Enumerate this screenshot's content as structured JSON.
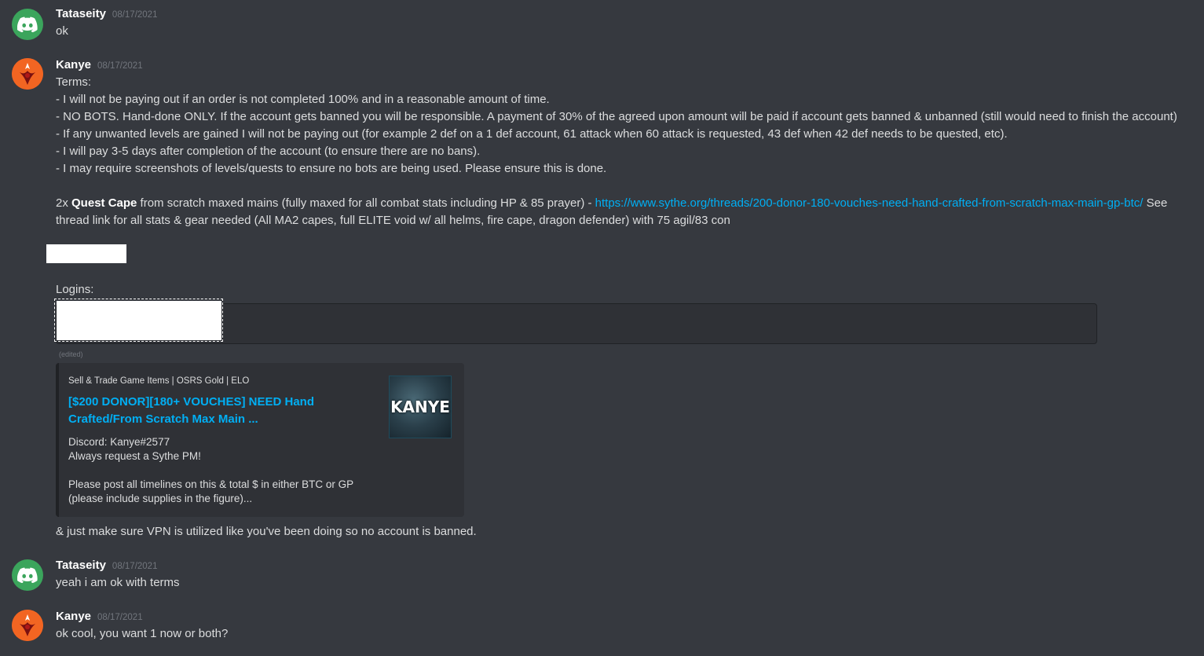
{
  "messages": [
    {
      "username": "Tataseity",
      "timestamp": "08/17/2021",
      "text": "ok"
    },
    {
      "username": "Kanye",
      "timestamp": "08/17/2021",
      "lines": [
        "Terms:",
        "- I will not be paying out if an order is not completed 100% and in a reasonable amount of time.",
        "- NO BOTS. Hand-done ONLY. If the account gets banned you will be responsible. A payment of 30% of the agreed upon amount will be paid if account gets banned & unbanned (still would need to finish the account)",
        "- If any unwanted levels are gained I will not be paying out (for example 2 def on a 1 def account, 61 attack when 60 attack is requested, 43 def when 42 def needs to be quested, etc).",
        "- I will pay 3-5 days after completion of the account (to ensure there are no bans).",
        "- I may require screenshots of levels/quests to ensure no bots are being used. Please ensure this is done."
      ],
      "quest_prefix": "2x ",
      "quest_bold": "Quest Cape",
      "quest_middle": " from scratch maxed mains (fully maxed for all combat stats including HP & 85 prayer) - ",
      "quest_link": "https://www.sythe.org/threads/200-donor-180-vouches-need-hand-crafted-from-scratch-max-main-gp-btc/",
      "quest_suffix": " See",
      "quest_line2": "thread link for all stats & gear needed (All MA2 capes, full ELITE void w/ all helms, fire cape, dragon defender) with 75 agil/83 con",
      "logins_label": "Logins:",
      "edited_label": "(edited)",
      "embed": {
        "provider": "Sell & Trade Game Items | OSRS Gold | ELO",
        "title_line1": "[$200 DONOR][180+ VOUCHES] NEED Hand",
        "title_line2": "Crafted/From Scratch Max Main ...",
        "desc_lines": [
          "Discord: Kanye#2577",
          "Always request a Sythe PM!",
          "",
          "Please post all timelines on this & total $ in either BTC or GP",
          "(please include supplies in the figure)..."
        ],
        "thumbnail_text": "KANYE"
      },
      "followup": "& just make sure VPN is utilized like you've been doing so no account is banned."
    },
    {
      "username": "Tataseity",
      "timestamp": "08/17/2021",
      "text": "yeah i am ok with terms"
    },
    {
      "username": "Kanye",
      "timestamp": "08/17/2021",
      "text": "ok cool, you want 1 now or both?"
    }
  ],
  "colors": {
    "background": "#36393f",
    "link": "#00aff4",
    "discord_avatar": "#3ba55c",
    "kanye_avatar": "#f26522"
  }
}
